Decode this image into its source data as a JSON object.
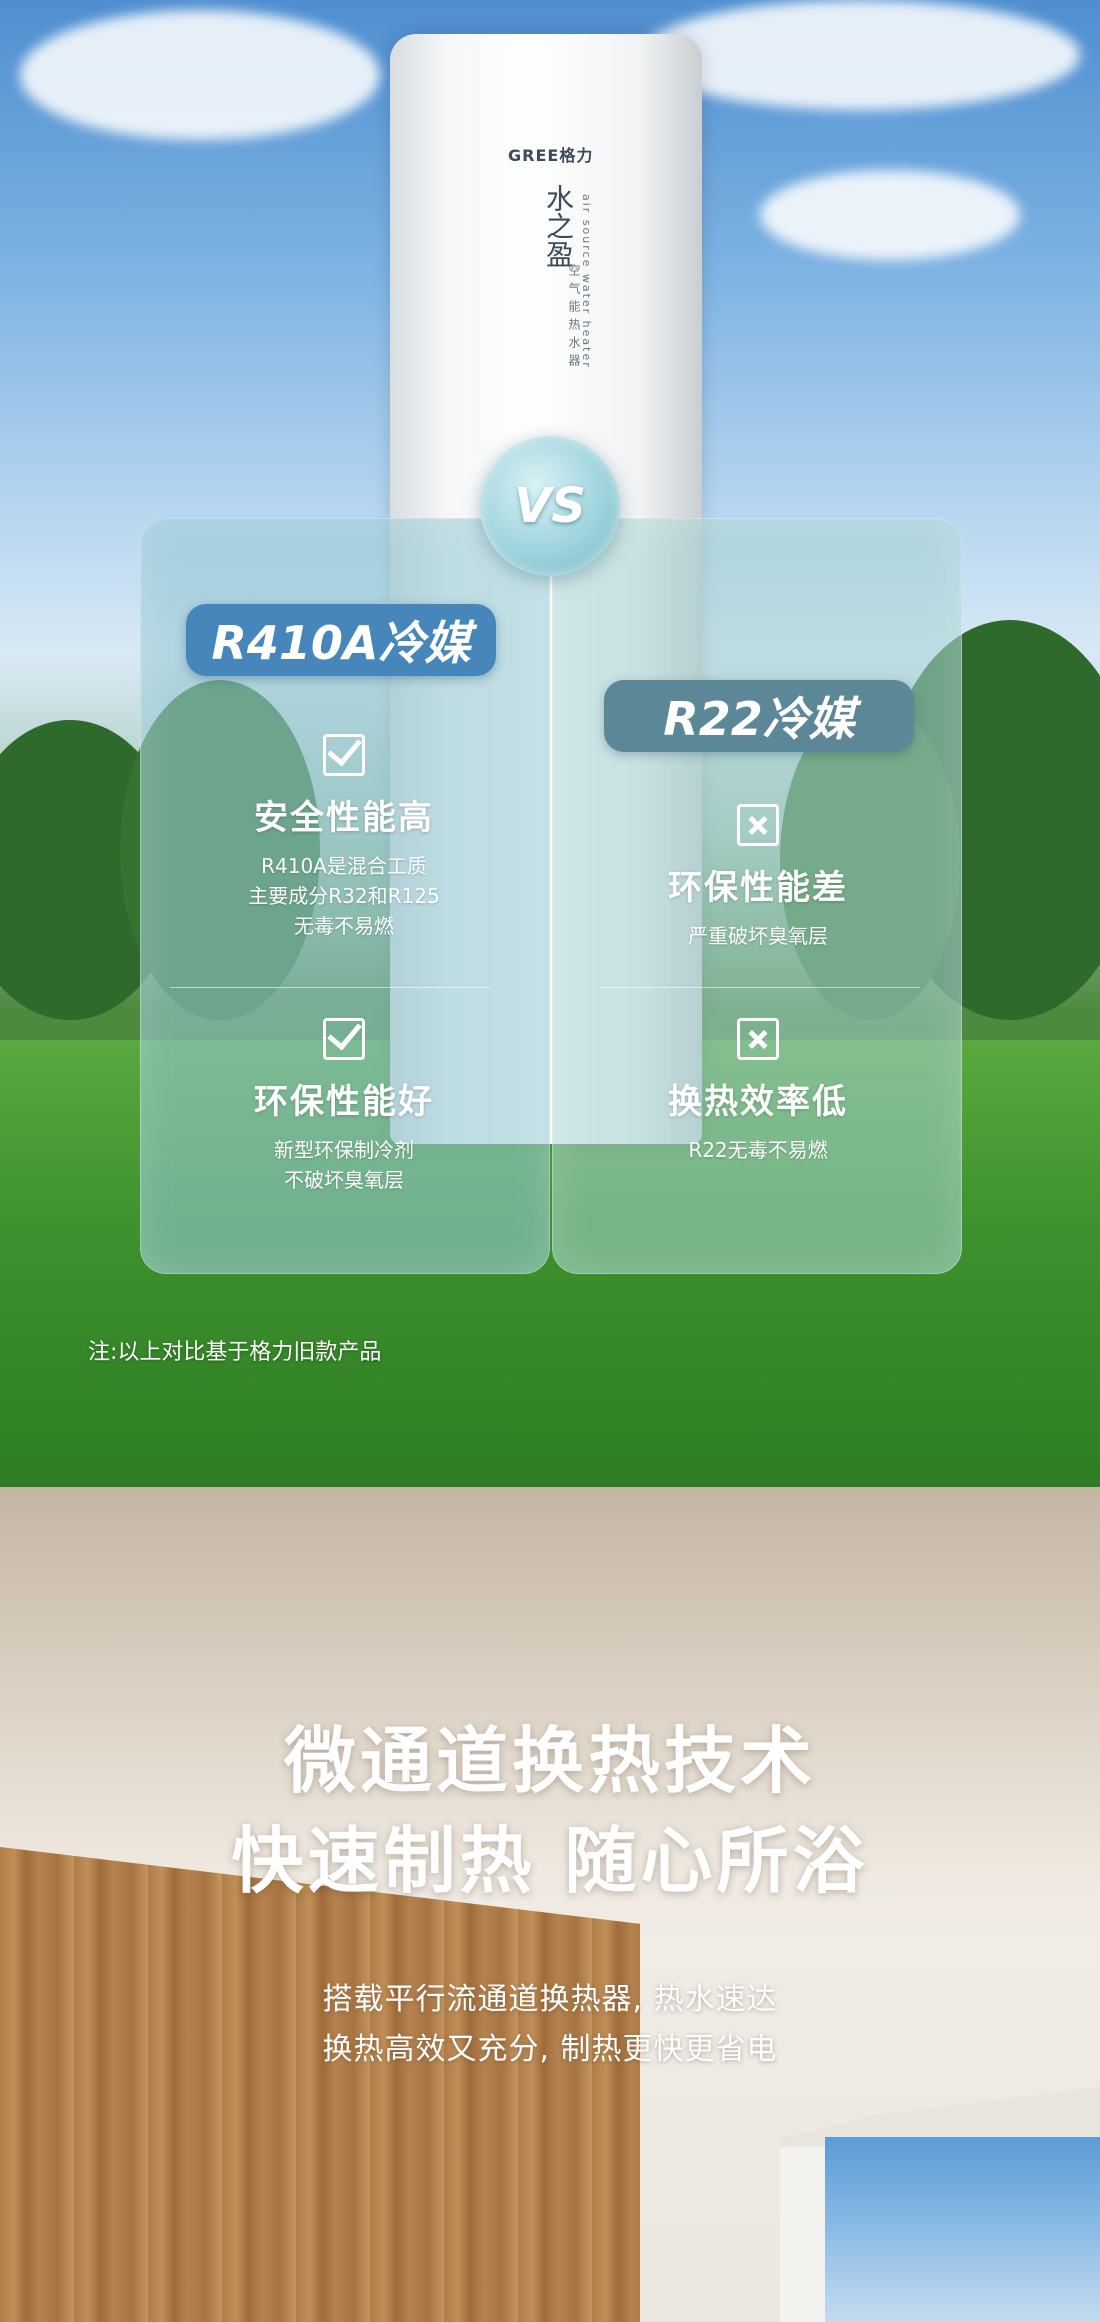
{
  "comparison": {
    "vs_label": "VS",
    "heater": {
      "brand": "GREE格力",
      "name": "水之盈",
      "english": "air source water heater",
      "category": "空气能热水器"
    },
    "left": {
      "tag": "R410A冷媒",
      "features": [
        {
          "icon": "check-icon",
          "title": "安全性能高",
          "lines": [
            "R410A是混合工质",
            "主要成分R32和R125",
            "无毒不易燃"
          ]
        },
        {
          "icon": "check-icon",
          "title": "环保性能好",
          "lines": [
            "新型环保制冷剂",
            "不破坏臭氧层"
          ]
        }
      ]
    },
    "right": {
      "tag": "R22冷媒",
      "features": [
        {
          "icon": "cross-icon",
          "title": "环保性能差",
          "lines": [
            "严重破坏臭氧层"
          ]
        },
        {
          "icon": "cross-icon",
          "title": "换热效率低",
          "lines": [
            "R22无毒不易燃"
          ]
        }
      ]
    },
    "note": "注:以上对比基于格力旧款产品"
  },
  "tech": {
    "title_line1": "微通道换热技术",
    "title_line2": "快速制热  随心所浴",
    "sub_line1": "搭载平行流通道换热器, 热水速达",
    "sub_line2": "换热高效又充分, 制热更快更省电"
  }
}
